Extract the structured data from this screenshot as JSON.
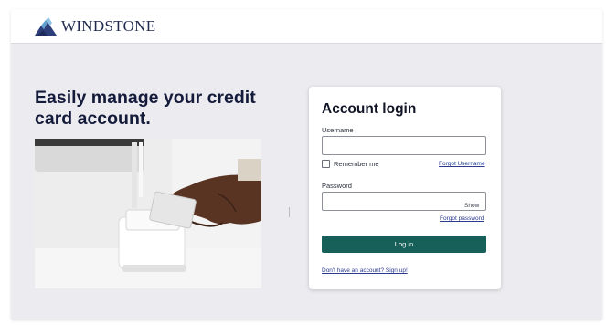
{
  "brand": {
    "name": "WINDSTONE",
    "logo_icon": "windstone-mountain-logo",
    "color": "#1f2a4d"
  },
  "hero": {
    "headline": "Easily manage your credit card account.",
    "image": "hand-inserting-credit-card-into-card-reader-photo"
  },
  "login": {
    "title": "Account login",
    "username": {
      "label": "Username",
      "value": "",
      "placeholder": ""
    },
    "remember_me_label": "Remember me",
    "remember_me_checked": false,
    "forgot_username": "Forgot Username",
    "password": {
      "label": "Password",
      "value": "",
      "placeholder": ""
    },
    "show_toggle": "Show",
    "forgot_password": "Forgot password",
    "login_button": "Log in",
    "signup_link": "Don't have an account? Sign up!"
  },
  "colors": {
    "accent": "#17605a",
    "link": "#2b3a8f",
    "background": "#ebebf0"
  }
}
